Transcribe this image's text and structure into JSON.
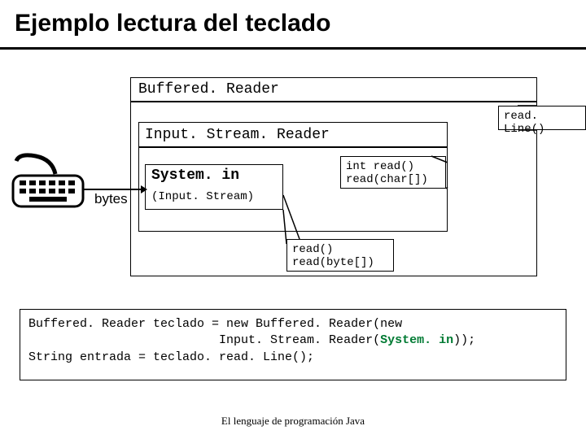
{
  "title": "Ejemplo lectura del teclado",
  "diagram": {
    "bufferedReader": "Buffered. Reader",
    "inputStreamReader": "Input. Stream. Reader",
    "systemIn": "System. in",
    "systemInSubtitle": "(Input. Stream)",
    "bytesLabel": "bytes",
    "readLine": "read. Line()",
    "intRead": "int read()",
    "readCharArr": "read(char[])",
    "readPlain": "read()",
    "readByteArr": "read(byte[])"
  },
  "code": {
    "line1a": "Buffered. Reader teclado = new Buffered. Reader(new",
    "line1b": "                          Input. Stream. Reader(",
    "line1c_sys": "System. in",
    "line1c_end": "));",
    "line2": "String entrada = teclado. read. Line();"
  },
  "footer": "El lenguaje de programación Java"
}
